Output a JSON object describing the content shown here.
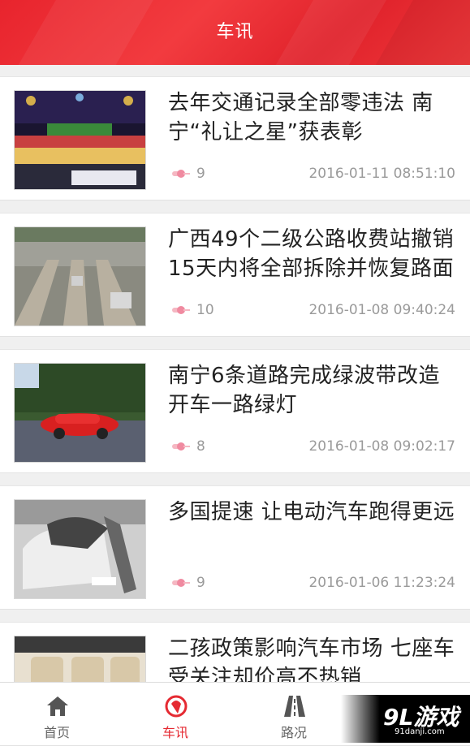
{
  "header": {
    "title": "车讯"
  },
  "articles": [
    {
      "title": "去年交通记录全部零违法 南宁“礼让之星”获表彰",
      "views": "9",
      "date": "2016-01-11 08:51:10"
    },
    {
      "title": "广西49个二级公路收费站撤销 15天内将全部拆除并恢复路面",
      "views": "10",
      "date": "2016-01-08 09:40:24"
    },
    {
      "title": "南宁6条道路完成绿波带改造 开车一路绿灯",
      "views": "8",
      "date": "2016-01-08 09:02:17"
    },
    {
      "title": "多国提速 让电动汽车跑得更远",
      "views": "9",
      "date": "2016-01-06 11:23:24"
    },
    {
      "title": "二孩政策影响汽车市场 七座车受关注却价高不热销",
      "views": "",
      "date": ""
    }
  ],
  "tabbar": {
    "tabs": [
      {
        "label": "首页",
        "icon": "home-icon",
        "active": false
      },
      {
        "label": "车讯",
        "icon": "news-icon",
        "active": true
      },
      {
        "label": "路况",
        "icon": "road-icon",
        "active": false
      }
    ]
  },
  "watermark": {
    "logo": "9L游戏",
    "url": "91danji.com"
  },
  "colors": {
    "accent": "#e52a32",
    "header": "#ec2b31"
  }
}
